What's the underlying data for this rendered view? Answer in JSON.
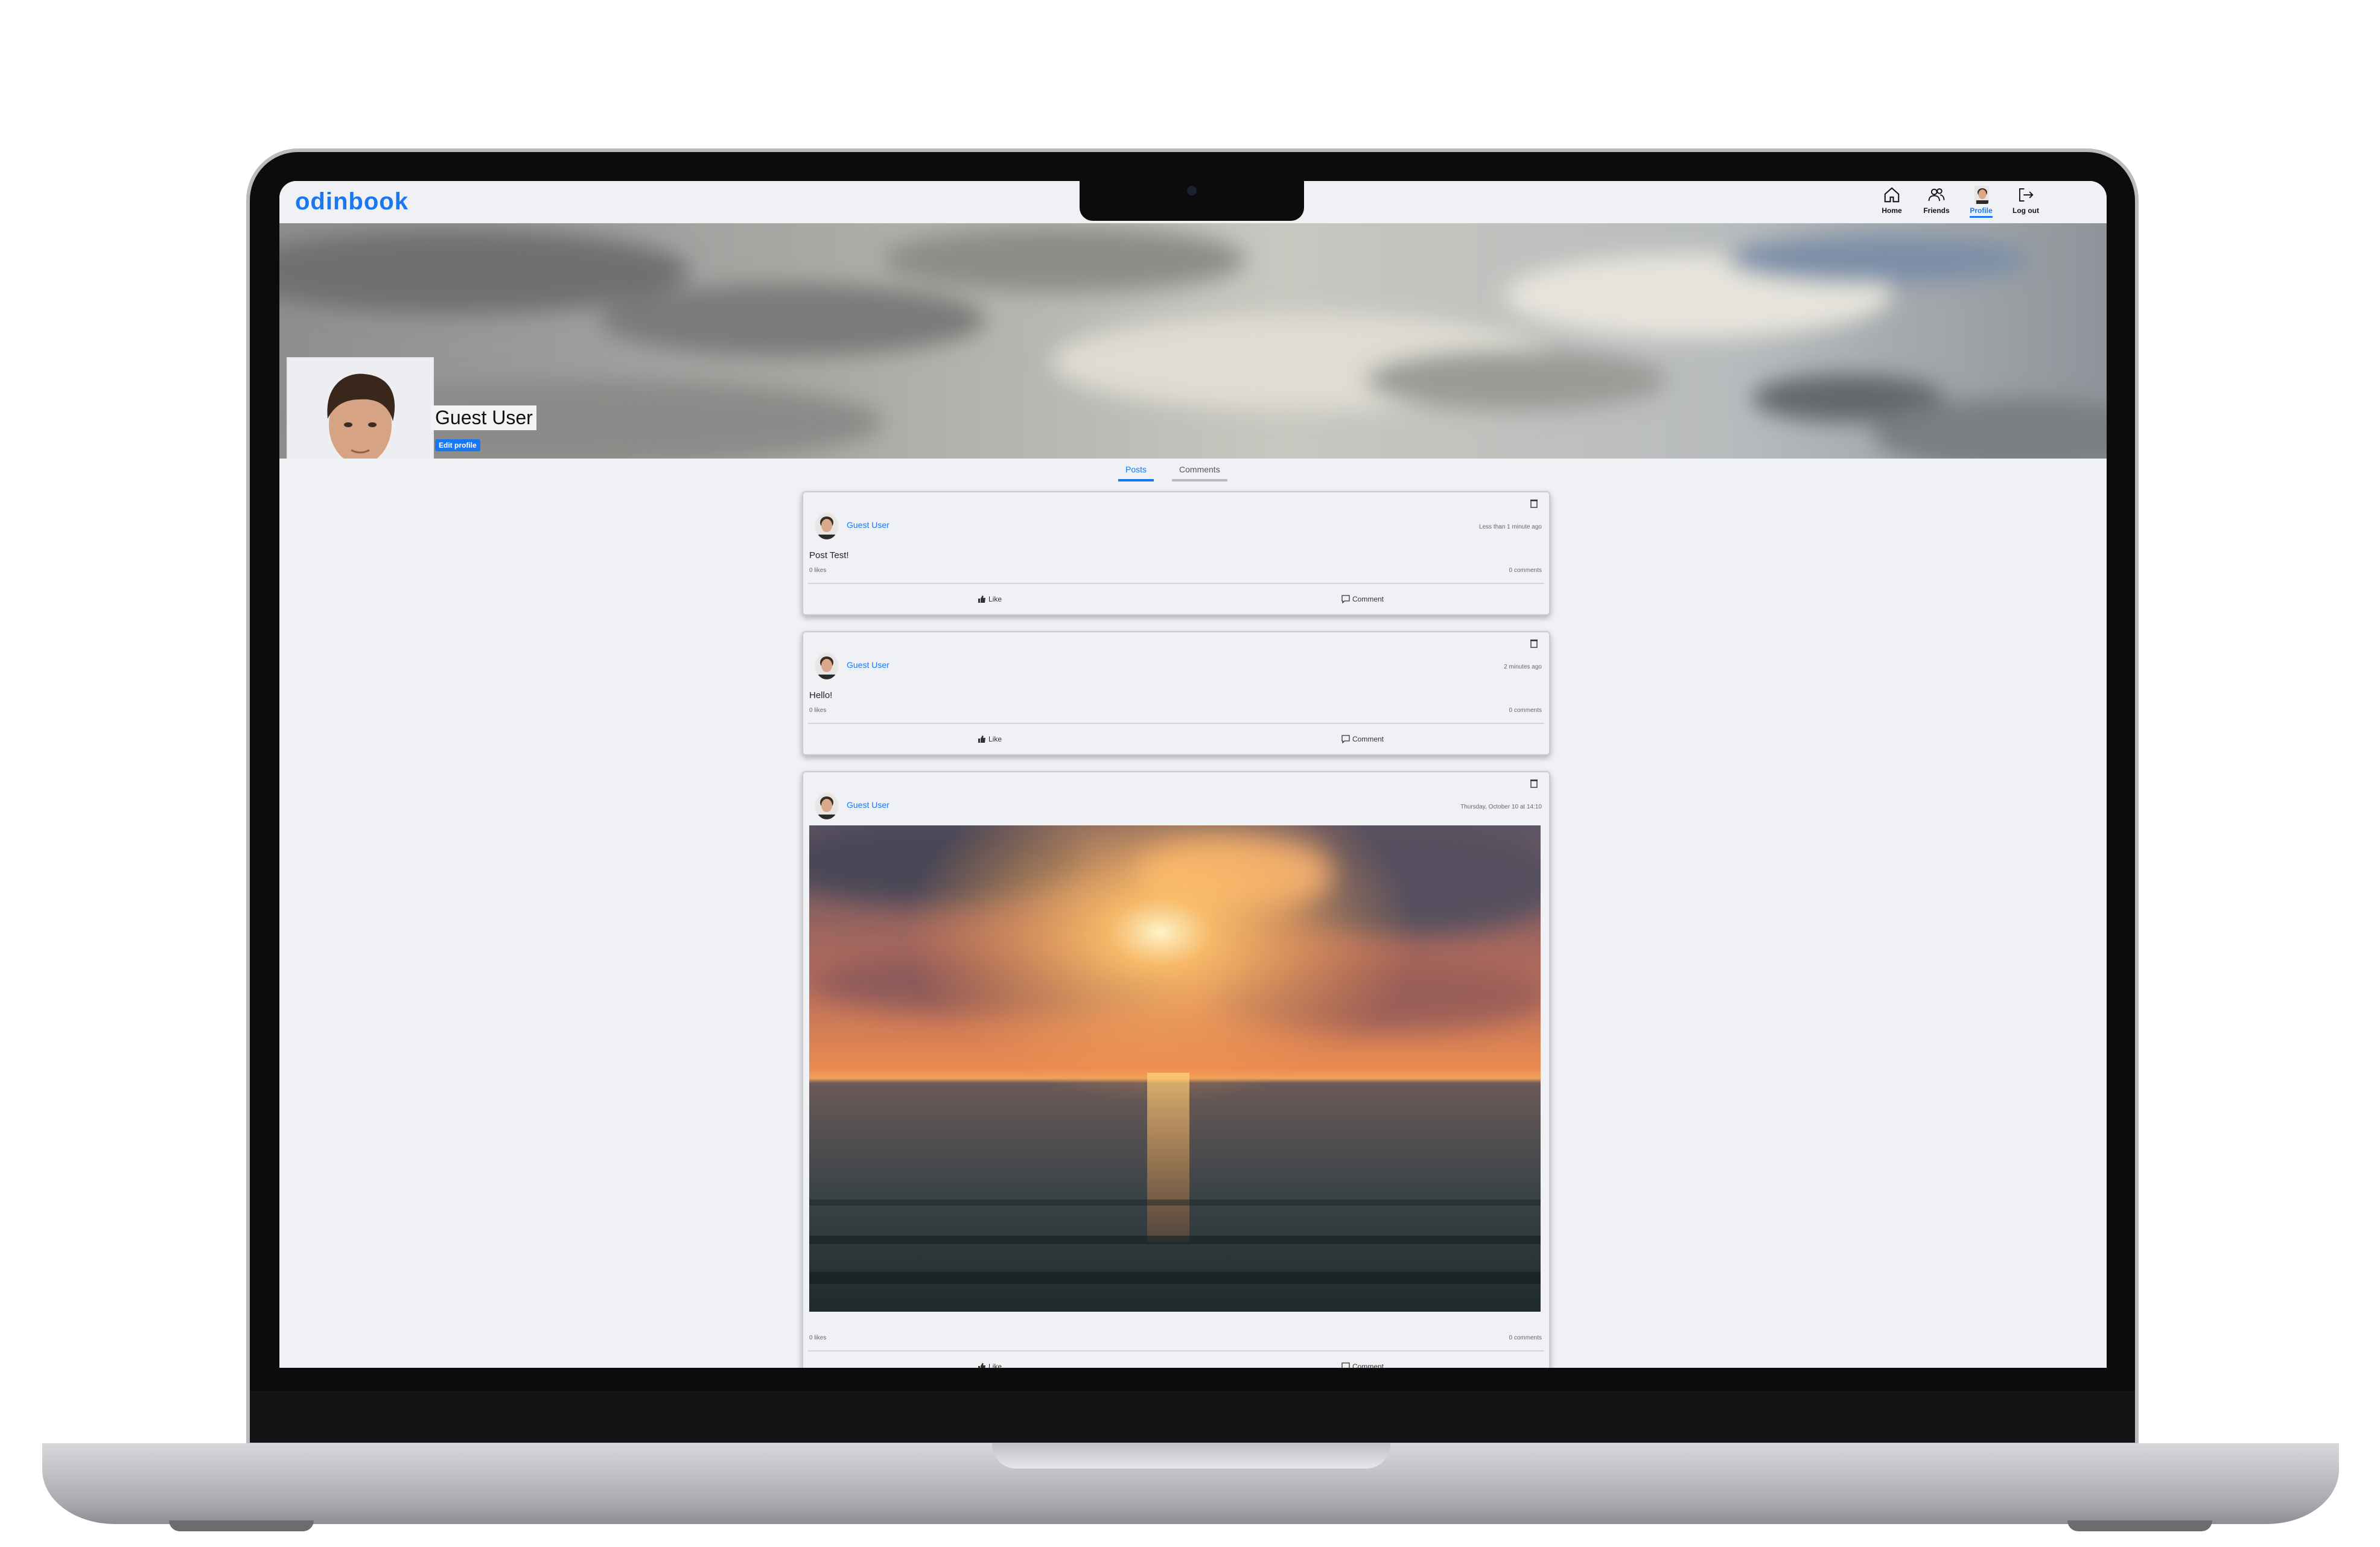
{
  "app": {
    "logo": "odinbook"
  },
  "nav": {
    "items": [
      {
        "label": "Home",
        "icon": "home-icon"
      },
      {
        "label": "Friends",
        "icon": "friends-icon"
      },
      {
        "label": "Profile",
        "icon": "avatar",
        "active": true
      },
      {
        "label": "Log out",
        "icon": "logout-icon"
      }
    ]
  },
  "profile": {
    "name": "Guest User",
    "edit_label": "Edit profile"
  },
  "tabs": [
    {
      "label": "Posts",
      "active": true
    },
    {
      "label": "Comments",
      "active": false
    }
  ],
  "posts": [
    {
      "author": "Guest User",
      "time": "Less than 1 minute ago",
      "text": "Post Test!",
      "likes": "0 likes",
      "comments": "0 comments",
      "like_label": "Like",
      "comment_label": "Comment"
    },
    {
      "author": "Guest User",
      "time": "2 minutes ago",
      "text": "Hello!",
      "likes": "0 likes",
      "comments": "0 comments",
      "like_label": "Like",
      "comment_label": "Comment"
    },
    {
      "author": "Guest User",
      "time": "Thursday, October 10 at 14:10",
      "text": "",
      "image": "sunset over the sea",
      "likes": "0 likes",
      "comments": "0 comments",
      "like_label": "Like",
      "comment_label": "Comment"
    }
  ],
  "colors": {
    "accent": "#1877f2",
    "background": "#f0f1f4"
  }
}
